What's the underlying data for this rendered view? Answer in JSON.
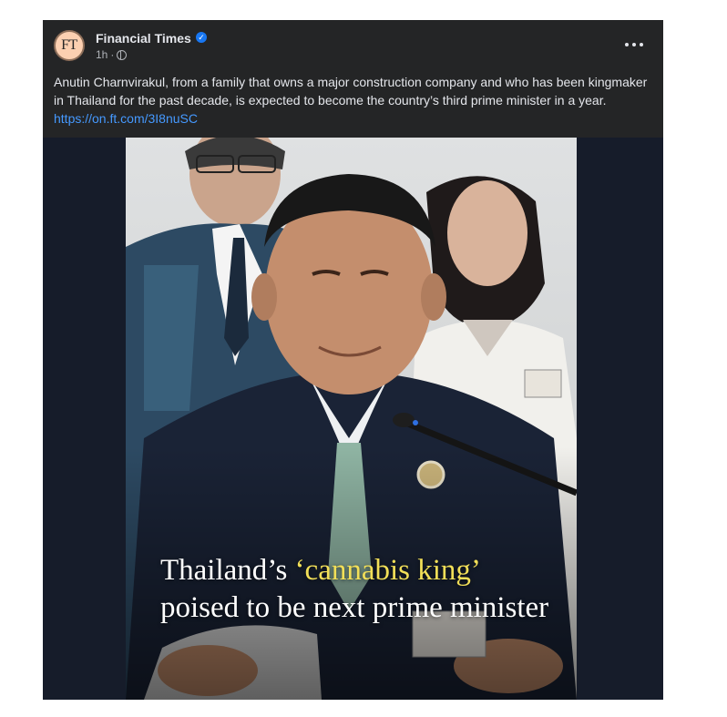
{
  "post": {
    "page_name": "Financial Times",
    "avatar_text": "FT",
    "verified_icon": "verified-check-icon",
    "timestamp": "1h",
    "separator": "·",
    "audience_icon": "globe-icon",
    "more_icon": "more-options-icon",
    "caption_text": "Anutin Charnvirakul, from a family that owns a major construction company and who has been kingmaker in Thailand for the past decade, is expected to become the country’s third prime minister in a year. ",
    "caption_link": "https://on.ft.com/3I8nuSC"
  },
  "image": {
    "headline_part1": "Thailand’s ",
    "headline_highlight": "‘cannabis king’",
    "headline_part2": "poised to be next prime minister"
  },
  "colors": {
    "card_background": "#242526",
    "link": "#4599ff",
    "highlight": "#f2df58",
    "media_background": "#161c2a",
    "avatar_background": "#fcd0b1"
  }
}
